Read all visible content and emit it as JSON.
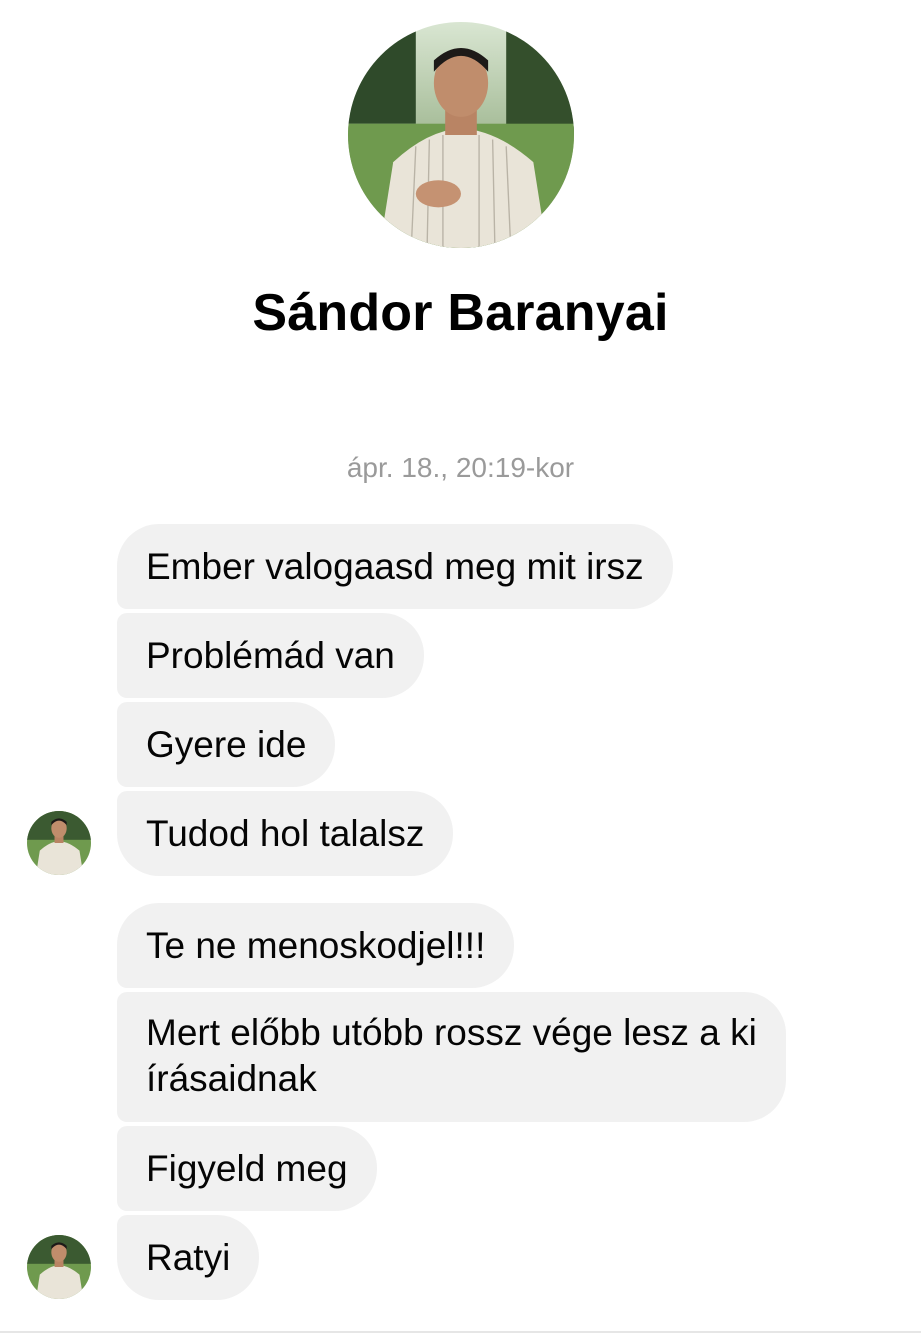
{
  "contact": {
    "name": "Sándor Baranyai",
    "photo_icon": "profile-photo",
    "avatar_icon": "avatar"
  },
  "conversation": {
    "timestamp": "ápr. 18., 20:19-kor",
    "messages": [
      "Ember valogaasd meg mit irsz",
      "Problémád van",
      "Gyere ide",
      "Tudod hol talalsz",
      "Te ne menoskodjel!!!",
      "Mert előbb utóbb rossz vége lesz a ki írásaidnak",
      "Figyeld meg",
      "Ratyi"
    ]
  },
  "colors": {
    "bubble_bg": "#f1f1f1",
    "timestamp": "#9a9a9a",
    "name": "#000000"
  }
}
